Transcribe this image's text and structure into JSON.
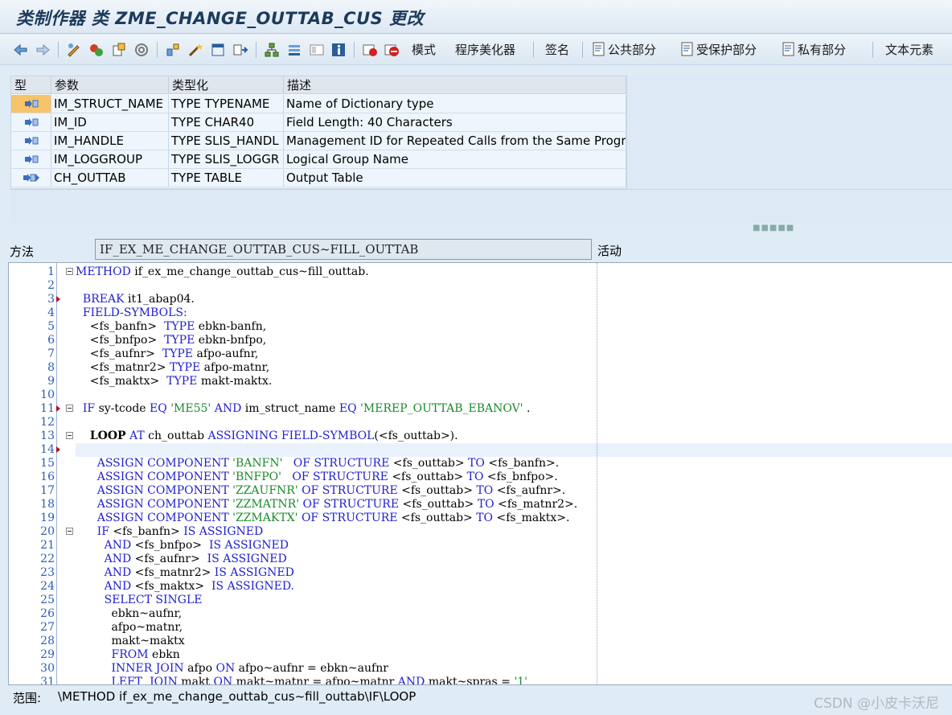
{
  "title": "类制作器 类 ZME_CHANGE_OUTTAB_CUS 更改",
  "toolbar": {
    "mode_label": "模式",
    "pretty_printer_label": "程序美化器",
    "signature_label": "签名",
    "public_label": "公共部分",
    "protected_label": "受保护部分",
    "private_label": "私有部分",
    "text_elements_label": "文本元素"
  },
  "params": {
    "headers": [
      "型",
      "参数",
      "类型化",
      "描述"
    ],
    "rows": [
      {
        "name": "IM_STRUCT_NAME",
        "typing": "TYPE TYPENAME",
        "desc": "Name of Dictionary type"
      },
      {
        "name": "IM_ID",
        "typing": "TYPE CHAR40",
        "desc": "Field Length: 40 Characters"
      },
      {
        "name": "IM_HANDLE",
        "typing": "TYPE SLIS_HANDL",
        "desc": "Management ID for Repeated Calls from the Same Program"
      },
      {
        "name": "IM_LOGGROUP",
        "typing": "TYPE SLIS_LOGGR",
        "desc": "Logical Group Name"
      },
      {
        "name": "CH_OUTTAB",
        "typing": "TYPE TABLE",
        "desc": "Output Table"
      }
    ]
  },
  "method": {
    "label": "方法",
    "value": "IF_EX_ME_CHANGE_OUTTAB_CUS~FILL_OUTTAB",
    "status": "活动"
  },
  "editor": {
    "line_numbers": [
      "1",
      "2",
      "3",
      "4",
      "5",
      "6",
      "7",
      "8",
      "9",
      "10",
      "11",
      "12",
      "13",
      "14",
      "15",
      "16",
      "17",
      "18",
      "19",
      "20",
      "21",
      "22",
      "23",
      "24",
      "25",
      "26",
      "27",
      "28",
      "29",
      "30",
      "31"
    ]
  },
  "status_bar": {
    "label": "范围:",
    "path": "\\METHOD if_ex_me_change_outtab_cus~fill_outtab\\IF\\LOOP"
  },
  "watermark": "CSDN @小皮卡沃尼",
  "colors": {
    "keyword": "#1f1fd0",
    "string": "#1a8a2a",
    "line_number": "#2b5eb8",
    "selected_row": "#f7c46a"
  }
}
